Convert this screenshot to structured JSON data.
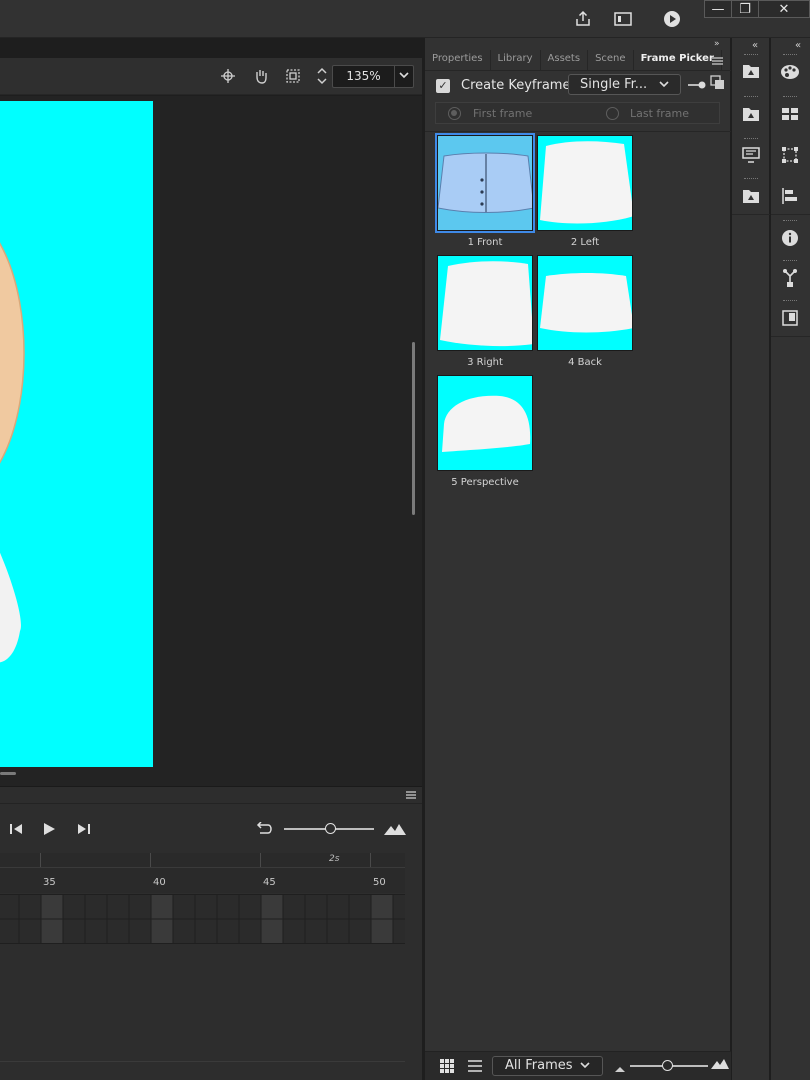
{
  "window": {
    "minimize_glyph": "—",
    "restore_glyph": "❐",
    "close_glyph": "✕"
  },
  "stage": {
    "zoom": "135%"
  },
  "panel": {
    "tabs": [
      "Properties",
      "Library",
      "Assets",
      "Scene",
      "Frame Picker"
    ],
    "active_tab": "Frame Picker",
    "create_keyframe_label": "Create Keyframe",
    "create_keyframe_checked": true,
    "mode_select": "Single Fr...",
    "first_frame_label": "First frame",
    "last_frame_label": "Last frame",
    "frames": [
      {
        "label": "1 Front",
        "selected": true
      },
      {
        "label": "2 Left",
        "selected": false
      },
      {
        "label": "3 Right",
        "selected": false
      },
      {
        "label": "4 Back",
        "selected": false
      },
      {
        "label": "5 Perspective",
        "selected": false
      }
    ],
    "filter_select": "All Frames"
  },
  "timeline": {
    "ruler_numbers": [
      "35",
      "40",
      "45",
      "50"
    ],
    "time_marker": "2s"
  },
  "colors": {
    "stage_bg": "#00ffff",
    "selection": "#3f8ae8"
  }
}
